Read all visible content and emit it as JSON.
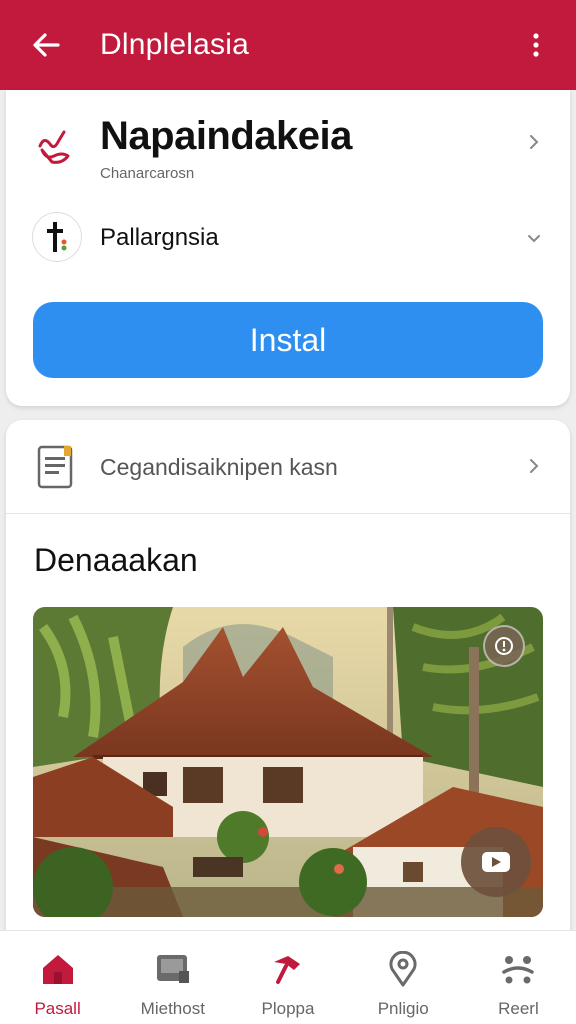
{
  "colors": {
    "appbar": "#c21a3d",
    "accent": "#c21a3d",
    "install": "#2f8ff0"
  },
  "appbar": {
    "title": "Dlnplelasia",
    "back_icon": "arrow-left-icon",
    "menu_icon": "more-vert-icon"
  },
  "app": {
    "name": "Napaindakeia",
    "subtitle": "Chanarcarosn",
    "icon": "app-logo-icon",
    "developer": "Pallargnsia",
    "install_label": "Instal"
  },
  "info_row": {
    "label": "Cegandisaiknipen kasn",
    "icon": "document-icon"
  },
  "section": {
    "title": "Denaaakan"
  },
  "photo": {
    "top_badge_icon": "info-icon",
    "play_badge_icon": "play-icon"
  },
  "bottom_nav": [
    {
      "label": "Pasall",
      "icon": "home-icon",
      "active": true
    },
    {
      "label": "Miethost",
      "icon": "screen-icon",
      "active": false
    },
    {
      "label": "Ploppa",
      "icon": "hammer-icon",
      "active": false
    },
    {
      "label": "Pnligio",
      "icon": "location-pin-icon",
      "active": false
    },
    {
      "label": "Reerl",
      "icon": "people-icon",
      "active": false
    }
  ]
}
